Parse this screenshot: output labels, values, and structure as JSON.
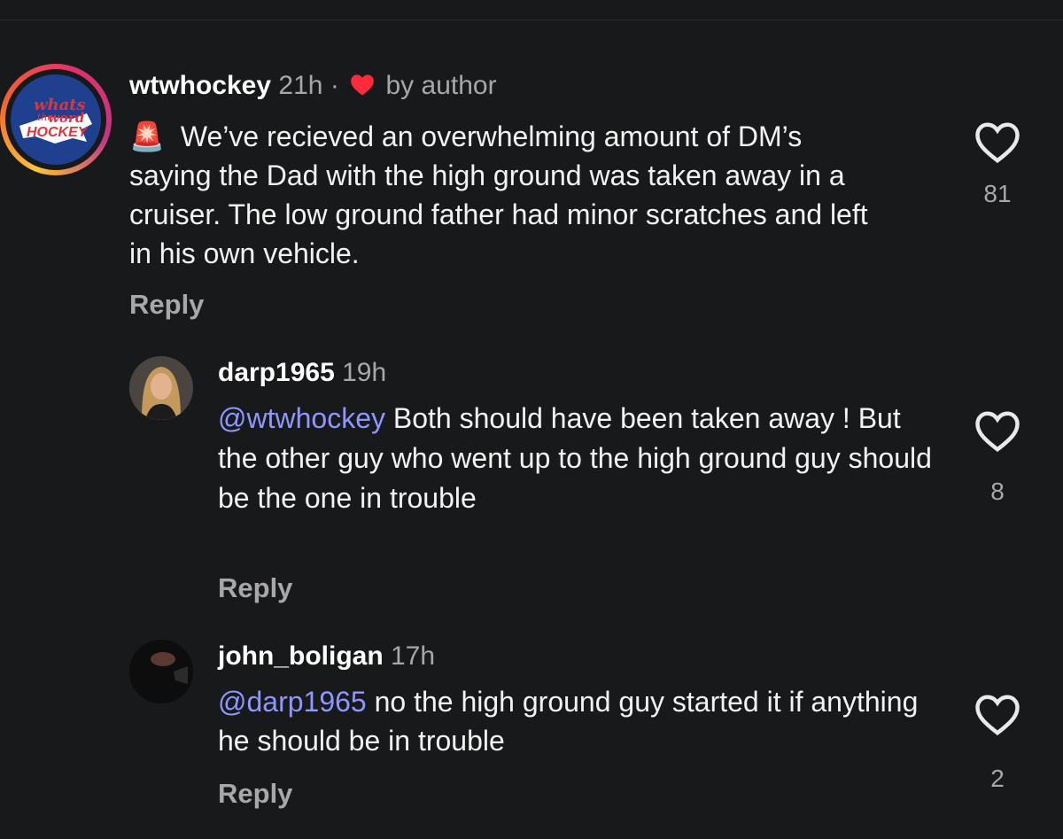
{
  "comments": [
    {
      "username": "wtwhockey",
      "time": "21h",
      "separator": "·",
      "badge": "by author",
      "badge_icon": "heart-filled-icon",
      "emoji": "🚨",
      "text": "We’ve recieved an overwhelming amount of DM’s saying the Dad with the high ground was taken away in a cruiser. The low ground father had minor scratches and left in his own vehicle.",
      "reply_label": "Reply",
      "likes": "81",
      "avatar_logo": {
        "line1": "whats",
        "line2": "the",
        "line3": "word",
        "line4": "HOCKEY"
      }
    },
    {
      "username": "darp1965",
      "time": "19h",
      "mention": "@wtwhockey",
      "text": " Both should have been taken away ! But the other guy who went up to the high ground guy should be the one in trouble",
      "reply_label": "Reply",
      "likes": "8"
    },
    {
      "username": "john_boligan",
      "time": "17h",
      "mention": "@darp1965",
      "text": " no the high ground guy started it if anything he should be in trouble",
      "reply_label": "Reply",
      "likes": "2"
    }
  ],
  "colors": {
    "background": "#18191b",
    "mention": "#8e97ff",
    "heart_red": "#ff2a3b",
    "muted": "#a8a8ab"
  }
}
